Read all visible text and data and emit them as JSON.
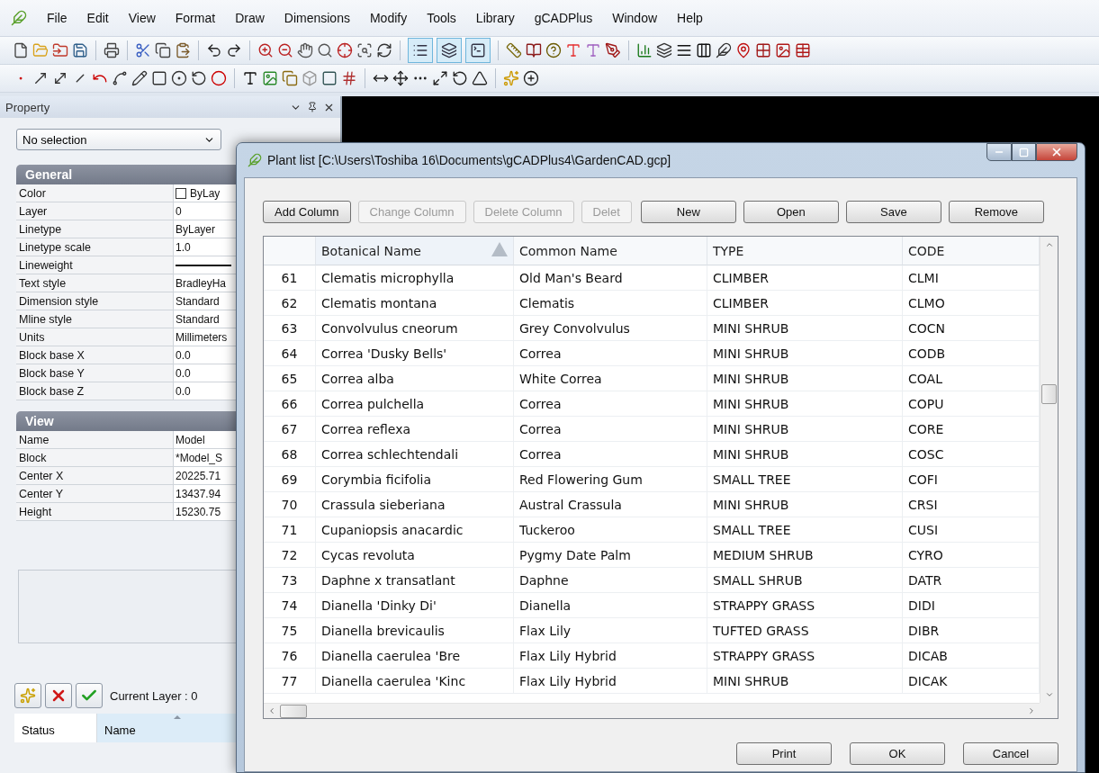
{
  "menu": [
    "File",
    "Edit",
    "View",
    "Format",
    "Draw",
    "Dimensions",
    "Modify",
    "Tools",
    "Library",
    "gCADPlus",
    "Window",
    "Help"
  ],
  "view_toggles": [
    {
      "on": true
    },
    {
      "on": true
    },
    {
      "on": true
    }
  ],
  "property_panel": {
    "title": "Property",
    "selection": "No selection",
    "sections": [
      {
        "title": "General",
        "rows": [
          {
            "label": "Color",
            "value": "ByLay",
            "kind": "color"
          },
          {
            "label": "Layer",
            "value": "0",
            "kind": "text"
          },
          {
            "label": "Linetype",
            "value": "ByLayer",
            "kind": "text"
          },
          {
            "label": "Linetype scale",
            "value": "1.0",
            "kind": "text"
          },
          {
            "label": "Lineweight",
            "kind": "line"
          },
          {
            "label": "Text style",
            "value": "BradleyHa",
            "kind": "text"
          },
          {
            "label": "Dimension style",
            "value": "Standard",
            "kind": "text"
          },
          {
            "label": "Mline style",
            "value": "Standard",
            "kind": "text"
          },
          {
            "label": "Units",
            "value": "Millimeters",
            "kind": "text"
          },
          {
            "label": "Block base X",
            "value": "0.0",
            "kind": "text"
          },
          {
            "label": "Block base Y",
            "value": "0.0",
            "kind": "text"
          },
          {
            "label": "Block base Z",
            "value": "0.0",
            "kind": "text"
          }
        ]
      },
      {
        "title": "View",
        "rows": [
          {
            "label": "Name",
            "value": "Model",
            "kind": "text"
          },
          {
            "label": "Block",
            "value": "*Model_S",
            "kind": "text"
          },
          {
            "label": "Center X",
            "value": "20225.71",
            "kind": "text"
          },
          {
            "label": "Center Y",
            "value": "13437.94",
            "kind": "text"
          },
          {
            "label": "Height",
            "value": "15230.75",
            "kind": "text"
          }
        ]
      }
    ]
  },
  "layer_panel": {
    "current": "Current Layer : 0",
    "columns": [
      {
        "label": "Status",
        "sorted": false
      },
      {
        "label": "Name",
        "sorted": true
      }
    ]
  },
  "dialog": {
    "title": "Plant list [C:\\Users\\Toshiba 16\\Documents\\gCADPlus4\\GardenCAD.gcp]",
    "buttons": [
      {
        "label": "Add Column",
        "disabled": false
      },
      {
        "label": "Change Column",
        "disabled": true
      },
      {
        "label": "Delete Column",
        "disabled": true
      },
      {
        "label": "Delet",
        "disabled": true
      },
      {
        "label": "New",
        "disabled": false
      },
      {
        "label": "Open",
        "disabled": false
      },
      {
        "label": "Save",
        "disabled": false
      },
      {
        "label": "Remove",
        "disabled": false
      }
    ],
    "columns": [
      {
        "label": "Botanical Name",
        "sorted": true
      },
      {
        "label": "Common Name",
        "sorted": false
      },
      {
        "label": "TYPE",
        "sorted": false
      },
      {
        "label": "CODE",
        "sorted": false
      }
    ],
    "rows": [
      {
        "n": "61",
        "cells": [
          "Clematis microphylla",
          "Old Man's Beard",
          "CLIMBER",
          "CLMI"
        ]
      },
      {
        "n": "62",
        "cells": [
          "Clematis montana",
          "Clematis",
          "CLIMBER",
          "CLMO"
        ]
      },
      {
        "n": "63",
        "cells": [
          "Convolvulus cneorum",
          "Grey Convolvulus",
          "MINI SHRUB",
          "COCN"
        ]
      },
      {
        "n": "64",
        "cells": [
          "Correa 'Dusky Bells'",
          "Correa",
          "MINI SHRUB",
          "CODB"
        ]
      },
      {
        "n": "65",
        "cells": [
          "Correa alba",
          "White Correa",
          "MINI SHRUB",
          "COAL"
        ]
      },
      {
        "n": "66",
        "cells": [
          "Correa pulchella",
          "Correa",
          "MINI SHRUB",
          "COPU"
        ]
      },
      {
        "n": "67",
        "cells": [
          "Correa reflexa",
          "Correa",
          "MINI SHRUB",
          "CORE"
        ]
      },
      {
        "n": "68",
        "cells": [
          "Correa schlechtendali",
          "Correa",
          "MINI SHRUB",
          "COSC"
        ]
      },
      {
        "n": "69",
        "cells": [
          "Corymbia ficifolia",
          "Red Flowering Gum",
          "SMALL TREE",
          "COFI"
        ]
      },
      {
        "n": "70",
        "cells": [
          "Crassula sieberiana",
          "Austral Crassula",
          "MINI SHRUB",
          "CRSI"
        ]
      },
      {
        "n": "71",
        "cells": [
          "Cupaniopsis anacardic",
          "Tuckeroo",
          "SMALL TREE",
          "CUSI"
        ]
      },
      {
        "n": "72",
        "cells": [
          "Cycas revoluta",
          "Pygmy Date Palm",
          "MEDIUM SHRUB",
          "CYRO"
        ]
      },
      {
        "n": "73",
        "cells": [
          "Daphne x transatlant",
          "Daphne",
          "SMALL SHRUB",
          "DATR"
        ]
      },
      {
        "n": "74",
        "cells": [
          "Dianella 'Dinky Di'",
          "Dianella",
          "STRAPPY GRASS",
          "DIDI"
        ]
      },
      {
        "n": "75",
        "cells": [
          "Dianella brevicaulis",
          "Flax Lily",
          "TUFTED GRASS",
          "DIBR"
        ]
      },
      {
        "n": "76",
        "cells": [
          "Dianella caerulea 'Bre",
          "Flax Lily Hybrid",
          "STRAPPY GRASS",
          "DICAB"
        ]
      },
      {
        "n": "77",
        "cells": [
          "Dianella caerulea 'Kinc",
          "Flax Lily Hybrid",
          "MINI SHRUB",
          "DICAK"
        ]
      }
    ],
    "footer_buttons": [
      "Print",
      "OK",
      "Cancel"
    ]
  }
}
